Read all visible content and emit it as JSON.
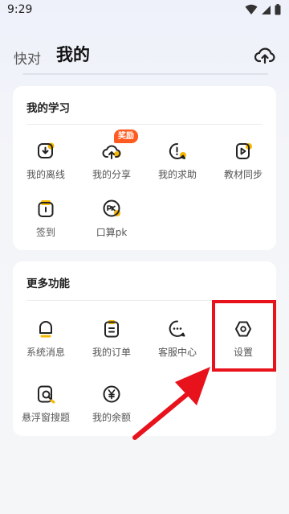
{
  "status_bar": {
    "time": "9:29"
  },
  "header": {
    "tabs": [
      "快对",
      "我的"
    ],
    "active_tab": "我的"
  },
  "upload_icon": "cloud-upload-icon",
  "study_section": {
    "title": "我的学习",
    "badge": "奖励",
    "items": [
      {
        "label": "我的离线",
        "icon": "download-icon"
      },
      {
        "label": "我的分享",
        "icon": "share-upload-icon"
      },
      {
        "label": "我的求助",
        "icon": "help-exclamation-icon"
      },
      {
        "label": "教材同步",
        "icon": "textbook-play-icon"
      },
      {
        "label": "签到",
        "icon": "calendar-checkin-icon"
      },
      {
        "label": "口算pk",
        "icon": "pk-battle-icon"
      }
    ]
  },
  "more_section": {
    "title": "更多功能",
    "items": [
      {
        "label": "系统消息",
        "icon": "bell-icon"
      },
      {
        "label": "我的订单",
        "icon": "order-clipboard-icon"
      },
      {
        "label": "客服中心",
        "icon": "chat-bubble-icon"
      },
      {
        "label": "设置",
        "icon": "settings-hexagon-icon"
      },
      {
        "label": "悬浮窗搜题",
        "icon": "floating-search-icon"
      },
      {
        "label": "我的余额",
        "icon": "yen-balance-icon"
      }
    ]
  },
  "colors": {
    "accent": "#f5b700",
    "highlight": "#e8121c",
    "badge": "#ff5a1f"
  }
}
